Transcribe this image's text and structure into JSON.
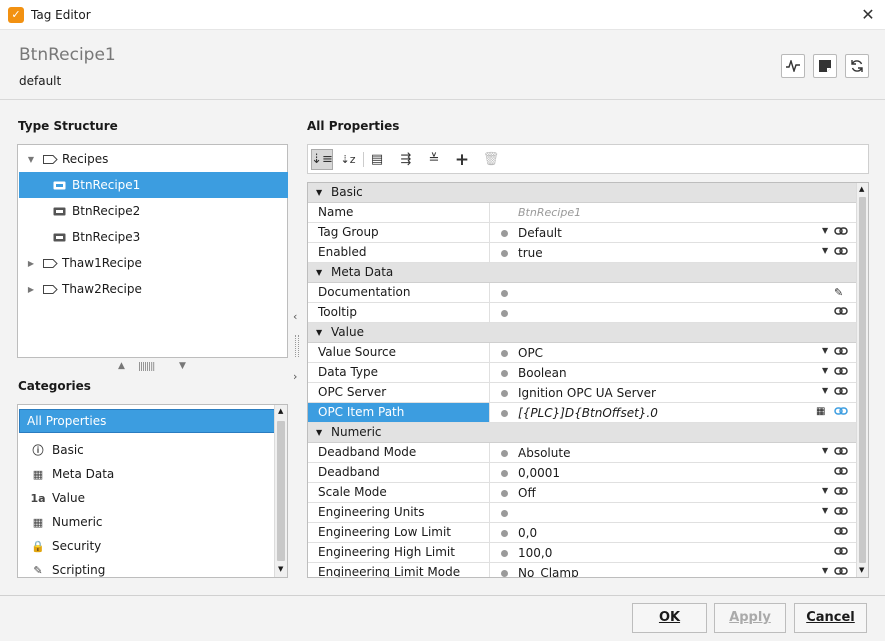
{
  "window": {
    "title": "Tag Editor",
    "close_glyph": "✕",
    "app_icon": "ignition-icon"
  },
  "header": {
    "tag_name": "BtnRecipe1",
    "provider": "default",
    "buttons": [
      "waveform-icon",
      "note-icon",
      "refresh-icon"
    ]
  },
  "type_structure": {
    "title": "Type Structure",
    "items": [
      {
        "label": "Recipes",
        "level": 0,
        "expanded": true,
        "icon": "folder-tag-icon"
      },
      {
        "label": "BtnRecipe1",
        "level": 1,
        "selected": true,
        "icon": "tag-instance-icon"
      },
      {
        "label": "BtnRecipe2",
        "level": 1,
        "icon": "tag-instance-icon"
      },
      {
        "label": "BtnRecipe3",
        "level": 1,
        "icon": "tag-instance-icon"
      },
      {
        "label": "Thaw1Recipe",
        "level": 0,
        "expanded": false,
        "icon": "folder-tag-icon"
      },
      {
        "label": "Thaw2Recipe",
        "level": 0,
        "expanded": false,
        "icon": "folder-tag-icon"
      }
    ]
  },
  "categories": {
    "title": "Categories",
    "items": [
      {
        "label": "All Properties",
        "selected": true,
        "icon": ""
      },
      {
        "label": "Basic",
        "icon": "info-icon"
      },
      {
        "label": "Meta Data",
        "icon": "metadata-icon"
      },
      {
        "label": "Value",
        "icon": "value-icon"
      },
      {
        "label": "Numeric",
        "icon": "calculator-icon"
      },
      {
        "label": "Security",
        "icon": "lock-icon"
      },
      {
        "label": "Scripting",
        "icon": "script-icon"
      }
    ]
  },
  "properties": {
    "title": "All Properties",
    "toolbar": [
      "sort-category-icon",
      "sort-alpha-icon",
      "list-icon",
      "expand-all-icon",
      "collapse-all-icon",
      "add-icon",
      "delete-icon"
    ],
    "rows": [
      {
        "type": "cat",
        "name": "Basic"
      },
      {
        "name": "Name",
        "value": "BtnRecipe1",
        "italic": true,
        "dot": false,
        "dd": false,
        "link": false,
        "muted": true
      },
      {
        "name": "Tag Group",
        "value": "Default",
        "dot": true,
        "dd": true,
        "link": true
      },
      {
        "name": "Enabled",
        "value": "true",
        "dot": true,
        "dd": true,
        "link": true
      },
      {
        "type": "cat",
        "name": "Meta Data"
      },
      {
        "name": "Documentation",
        "value": "",
        "dot": true,
        "dd": false,
        "link": false,
        "edit": true
      },
      {
        "name": "Tooltip",
        "value": "",
        "dot": true,
        "dd": false,
        "link": true
      },
      {
        "type": "cat",
        "name": "Value"
      },
      {
        "name": "Value Source",
        "value": "OPC",
        "dot": true,
        "dd": true,
        "link": true
      },
      {
        "name": "Data Type",
        "value": "Boolean",
        "dot": true,
        "dd": true,
        "link": true
      },
      {
        "name": "OPC Server",
        "value": "Ignition OPC UA Server",
        "dot": true,
        "dd": true,
        "link": true
      },
      {
        "name": "OPC Item Path",
        "value": "[{PLC}]D{BtnOffset}.0",
        "italic": true,
        "dot": true,
        "dd": false,
        "link": true,
        "browse": true,
        "selected": true
      },
      {
        "type": "cat",
        "name": "Numeric"
      },
      {
        "name": "Deadband Mode",
        "value": "Absolute",
        "dot": true,
        "dd": true,
        "link": true
      },
      {
        "name": "Deadband",
        "value": "0,0001",
        "dot": true,
        "dd": false,
        "link": true
      },
      {
        "name": "Scale Mode",
        "value": "Off",
        "dot": true,
        "dd": true,
        "link": true
      },
      {
        "name": "Engineering Units",
        "value": "",
        "dot": true,
        "dd": true,
        "link": true
      },
      {
        "name": "Engineering Low Limit",
        "value": "0,0",
        "dot": true,
        "dd": false,
        "link": true
      },
      {
        "name": "Engineering High Limit",
        "value": "100,0",
        "dot": true,
        "dd": false,
        "link": true
      },
      {
        "name": "Engineering Limit Mode",
        "value": "No_Clamp",
        "dot": true,
        "dd": true,
        "link": true
      }
    ]
  },
  "footer": {
    "ok": "OK",
    "apply": "Apply",
    "cancel": "Cancel"
  },
  "colors": {
    "selection": "#3c9de0",
    "app_icon": "#f29111"
  }
}
